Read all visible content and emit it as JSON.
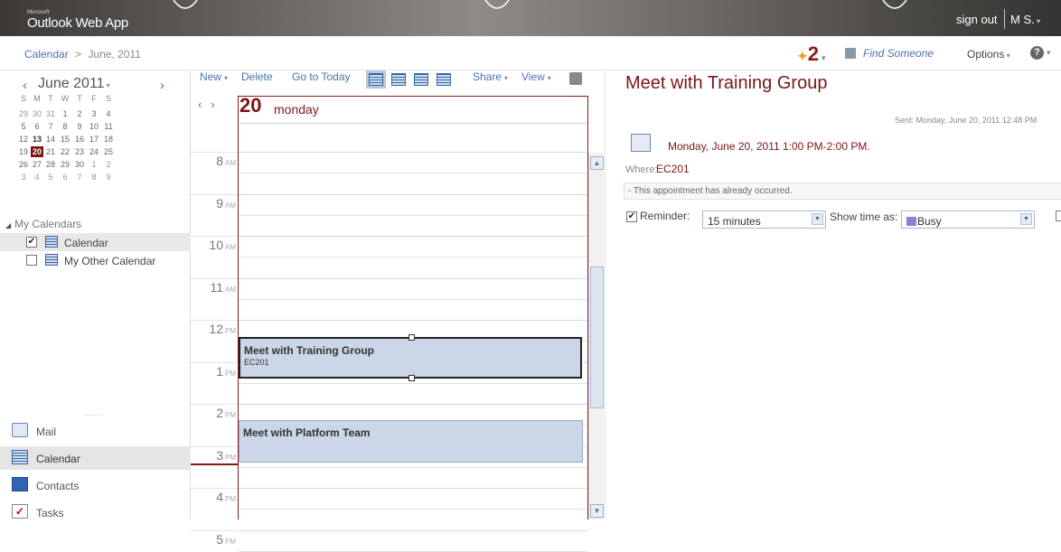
{
  "app": {
    "brand": "Microsoft",
    "title": "Outlook Web App",
    "sign_out": "sign out",
    "user": "M S."
  },
  "breadcrumb": {
    "root": "Calendar",
    "sep": ">",
    "current": "June, 2011"
  },
  "header": {
    "notification_count": "2",
    "find_someone": "Find Someone",
    "options": "Options",
    "help": "?"
  },
  "mini_calendar": {
    "month": "June 2011",
    "weekdays": [
      "S",
      "M",
      "T",
      "W",
      "T",
      "F",
      "S"
    ],
    "weeks": [
      [
        "29",
        "30",
        "31",
        "1",
        "2",
        "3",
        "4"
      ],
      [
        "5",
        "6",
        "7",
        "8",
        "9",
        "10",
        "11"
      ],
      [
        "12",
        "13",
        "14",
        "15",
        "16",
        "17",
        "18"
      ],
      [
        "19",
        "20",
        "21",
        "22",
        "23",
        "24",
        "25"
      ],
      [
        "26",
        "27",
        "28",
        "29",
        "30",
        "1",
        "2"
      ],
      [
        "3",
        "4",
        "5",
        "6",
        "7",
        "8",
        "9"
      ]
    ],
    "selected_day": "20"
  },
  "my_calendars": {
    "heading": "My Calendars",
    "items": [
      {
        "label": "Calendar",
        "checked": true
      },
      {
        "label": "My Other Calendar",
        "checked": false
      }
    ]
  },
  "nav": {
    "mail": "Mail",
    "calendar": "Calendar",
    "contacts": "Contacts",
    "tasks": "Tasks"
  },
  "toolbar": {
    "new": "New",
    "delete": "Delete",
    "go_to_today": "Go to Today",
    "share": "Share",
    "view": "View"
  },
  "day": {
    "number": "20",
    "name": "monday"
  },
  "hours": [
    {
      "h": "8",
      "ap": "AM"
    },
    {
      "h": "9",
      "ap": "AM"
    },
    {
      "h": "10",
      "ap": "AM"
    },
    {
      "h": "11",
      "ap": "AM"
    },
    {
      "h": "12",
      "ap": "PM"
    },
    {
      "h": "1",
      "ap": "PM"
    },
    {
      "h": "2",
      "ap": "PM"
    },
    {
      "h": "3",
      "ap": "PM"
    },
    {
      "h": "4",
      "ap": "PM"
    },
    {
      "h": "5",
      "ap": "PM"
    }
  ],
  "appointments": [
    {
      "title": "Meet with Training Group",
      "location": "EC201"
    },
    {
      "title": "Meet with Platform Team",
      "location": ""
    }
  ],
  "reading": {
    "title": "Meet with Training Group",
    "sent": "Sent: Monday, June 20, 2011 12:48 PM",
    "when": "Monday, June 20, 2011 1:00 PM-2:00 PM.",
    "where_label": "Where:",
    "where_value": "EC201",
    "info": "- This appointment has already occurred.",
    "reminder_label": "Reminder:",
    "reminder_value": "15 minutes",
    "show_time_label": "Show time as:",
    "show_time_value": "Busy"
  },
  "colors": {
    "accent": "#7b1616",
    "link": "#4a74a8",
    "appointment": "#cbd7e8",
    "busy": "#8b7fd6"
  }
}
